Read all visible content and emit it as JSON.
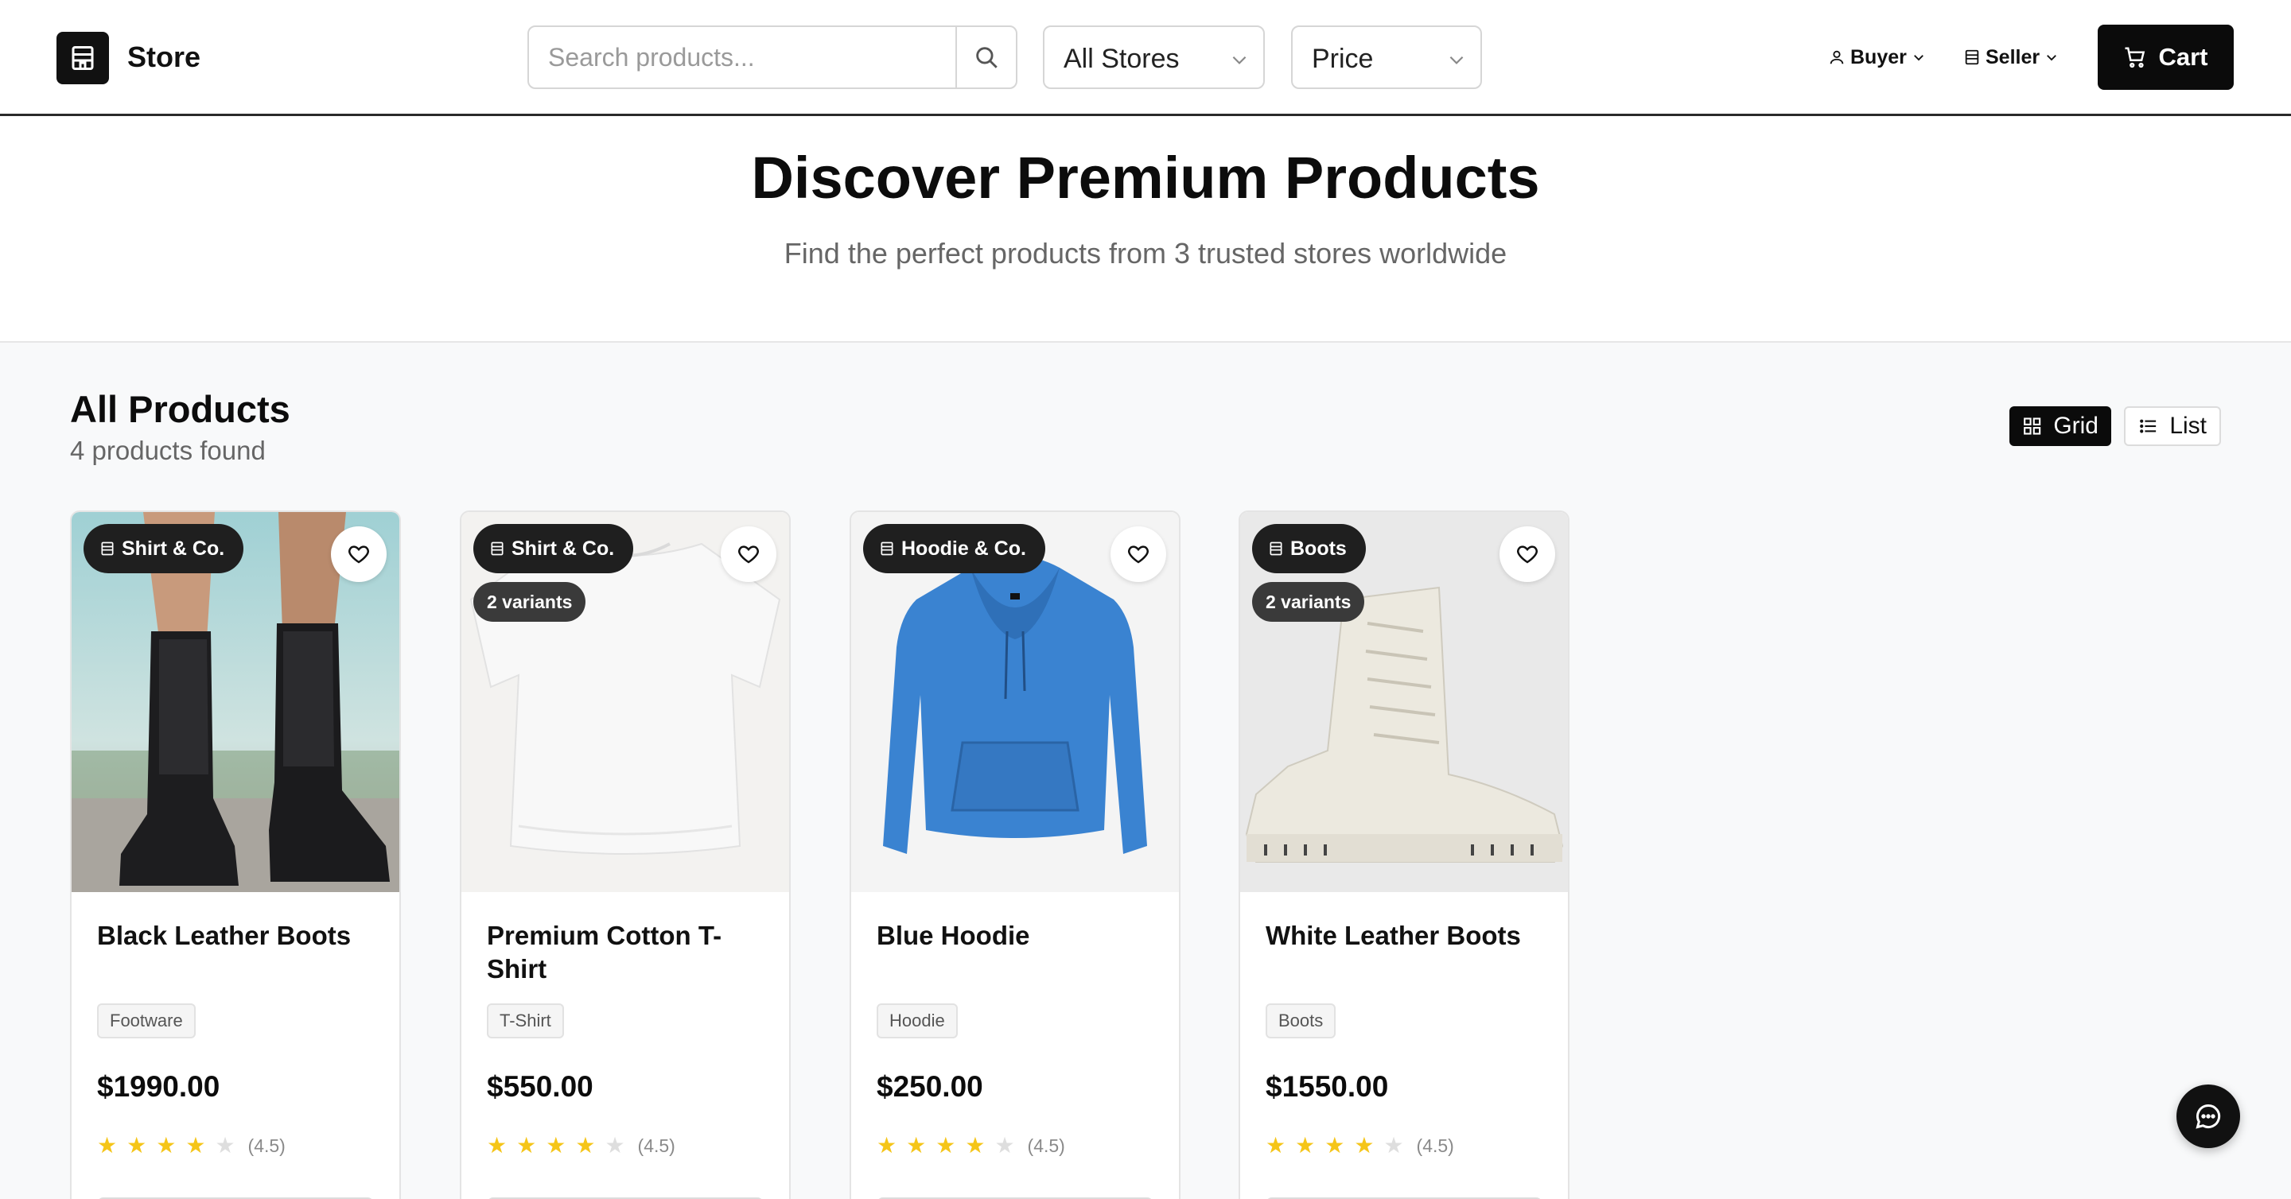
{
  "header": {
    "brand": "Store",
    "search_placeholder": "Search products...",
    "store_filter": "All Stores",
    "sort_filter": "Price",
    "buyer_label": "Buyer",
    "seller_label": "Seller",
    "cart_label": "Cart"
  },
  "hero": {
    "title": "Discover Premium Products",
    "subtitle": "Find the perfect products from 3 trusted stores worldwide"
  },
  "products_section": {
    "title": "All Products",
    "count": "4 products found",
    "view_grid": "Grid",
    "view_list": "List",
    "active_view": "Grid"
  },
  "products": [
    {
      "store": "Shirt & Co.",
      "variants": "",
      "name": "Black Leather Boots",
      "category": "Footware",
      "price": "$1990.00",
      "rating_text": "(4.5)",
      "rating": 4.5
    },
    {
      "store": "Shirt & Co.",
      "variants": "2 variants",
      "name": "Premium Cotton T-Shirt",
      "category": "T-Shirt",
      "price": "$550.00",
      "rating_text": "(4.5)",
      "rating": 4.5
    },
    {
      "store": "Hoodie & Co.",
      "variants": "",
      "name": "Blue Hoodie",
      "category": "Hoodie",
      "price": "$250.00",
      "rating_text": "(4.5)",
      "rating": 4.5
    },
    {
      "store": "Boots",
      "variants": "2 variants",
      "name": "White Leather Boots",
      "category": "Boots",
      "price": "$1550.00",
      "rating_text": "(4.5)",
      "rating": 4.5
    }
  ],
  "colors": {
    "primary": "#0b0b0b",
    "star": "#f5c518",
    "background": "#f8f9fa",
    "hoodie": "#3a83d1"
  },
  "icons": {
    "logo": "store-icon",
    "search": "search-icon",
    "chevron": "chevron-down-icon",
    "buyer": "user-icon",
    "seller": "store-icon",
    "cart": "cart-icon",
    "grid": "grid-icon",
    "list": "list-icon",
    "favorite": "heart-icon",
    "chat": "chat-icon"
  }
}
